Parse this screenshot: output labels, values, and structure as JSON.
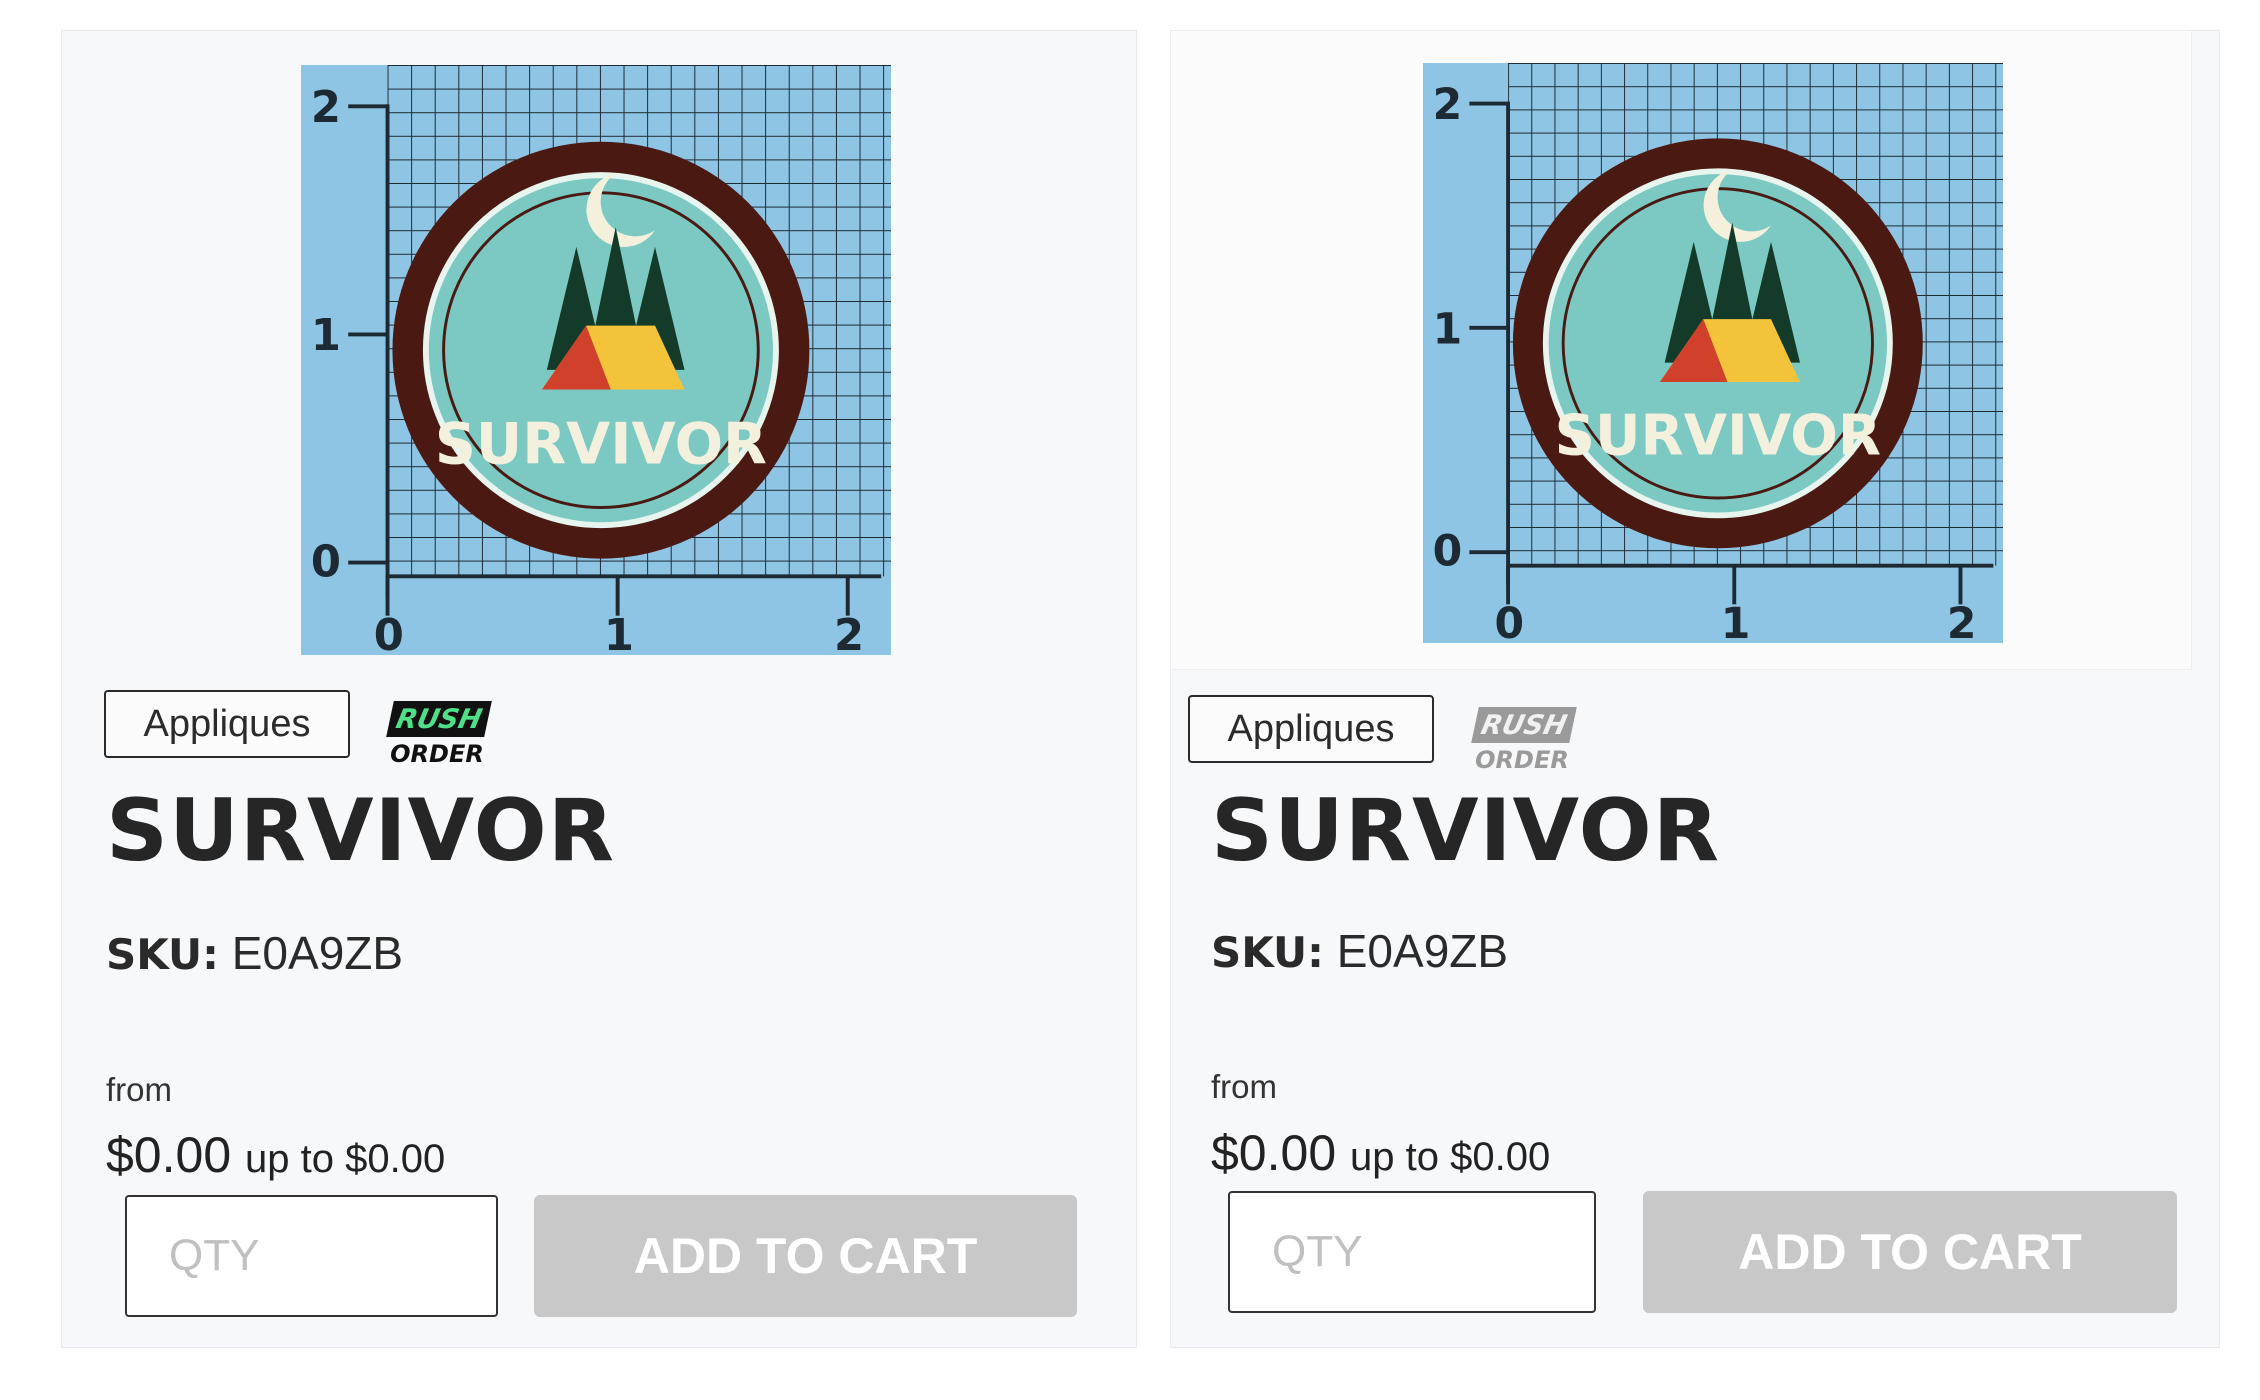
{
  "products": [
    {
      "category": "Appliques",
      "badge": {
        "top": "RUSH",
        "bottom": "ORDER",
        "state": "active"
      },
      "title": "SURVIVOR",
      "sku_label": "SKU:",
      "sku_value": "E0A9ZB",
      "price_prefix": "from",
      "price_from": "$0.00",
      "price_upto": "up to $0.00",
      "qty_placeholder": "QTY",
      "add_to_cart": "ADD TO CART",
      "image": {
        "patch_text": "SURVIVOR",
        "ruler_labels": {
          "y": [
            "2",
            "1",
            "0"
          ],
          "x": [
            "0",
            "1",
            "2"
          ]
        },
        "icon": "survivor-patch-image"
      }
    },
    {
      "category": "Appliques",
      "badge": {
        "top": "RUSH",
        "bottom": "ORDER",
        "state": "muted"
      },
      "title": "SURVIVOR",
      "sku_label": "SKU:",
      "sku_value": "E0A9ZB",
      "price_prefix": "from",
      "price_from": "$0.00",
      "price_upto": "up to $0.00",
      "qty_placeholder": "QTY",
      "add_to_cart": "ADD TO CART",
      "image": {
        "patch_text": "SURVIVOR",
        "ruler_labels": {
          "y": [
            "2",
            "1",
            "0"
          ],
          "x": [
            "0",
            "1",
            "2"
          ]
        },
        "icon": "survivor-patch-image"
      }
    }
  ],
  "colors": {
    "grid_background": "#8ec4e4",
    "patch_border": "#4a1a12",
    "patch_fill": "#7cc9c4",
    "button_disabled": "#c8c8c8",
    "rush_green": "#4fe08a"
  }
}
